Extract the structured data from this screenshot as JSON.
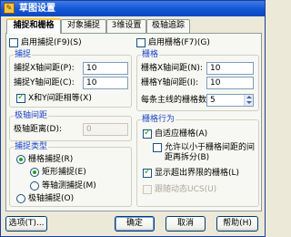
{
  "window": {
    "title": "草图设置",
    "icon_name": "app-icon"
  },
  "tabs": [
    {
      "label": "捕捉和栅格",
      "active": true
    },
    {
      "label": "对象捕捉",
      "active": false
    },
    {
      "label": "3维设置",
      "active": false
    },
    {
      "label": "极轴追踪",
      "active": false
    }
  ],
  "left": {
    "snap_on": {
      "label": "启用捕捉(F9)(S)",
      "checked": false
    },
    "snap_group": {
      "title": "捕捉",
      "x_label": "捕捉X轴间距(P):",
      "x_value": "10",
      "y_label": "捕捉Y轴间距(C):",
      "y_value": "10",
      "equal": {
        "label": "X和Y间距相等(X)",
        "checked": true
      }
    },
    "polar_group": {
      "title": "极轴间距",
      "dist_label": "极轴距离(D):",
      "dist_value": "0"
    },
    "type_group": {
      "title": "捕捉类型",
      "grid_snap": {
        "label": "栅格捕捉(R)",
        "selected": true
      },
      "rect_snap": {
        "label": "矩形捕捉(E)",
        "selected": true
      },
      "iso_snap": {
        "label": "等轴测捕捉(M)",
        "selected": false
      },
      "polar_snap": {
        "label": "极轴捕捉(O)",
        "selected": false
      }
    }
  },
  "right": {
    "grid_on": {
      "label": "启用栅格(F7)(G)",
      "checked": false
    },
    "grid_group": {
      "title": "栅格",
      "x_label": "栅格X轴间距(N):",
      "x_value": "10",
      "y_label": "栅格Y轴间距(I):",
      "y_value": "10",
      "major_label": "每条主线的栅格数",
      "major_value": "5"
    },
    "behavior_group": {
      "title": "栅格行为",
      "adaptive": {
        "label": "自适应栅格(A)",
        "checked": true
      },
      "subdivide": {
        "label1": "允许以小于栅格间距的间",
        "label2": "距再拆分(B)",
        "checked": false
      },
      "beyond": {
        "label": "显示超出界限的栅格(L)",
        "checked": true
      },
      "dynamic_ucs": {
        "label": "跟随动态UCS(U)",
        "checked": false
      }
    }
  },
  "footer": {
    "options": "选项(T)...",
    "ok": "确定",
    "cancel": "取消",
    "help": "帮助(H)"
  }
}
